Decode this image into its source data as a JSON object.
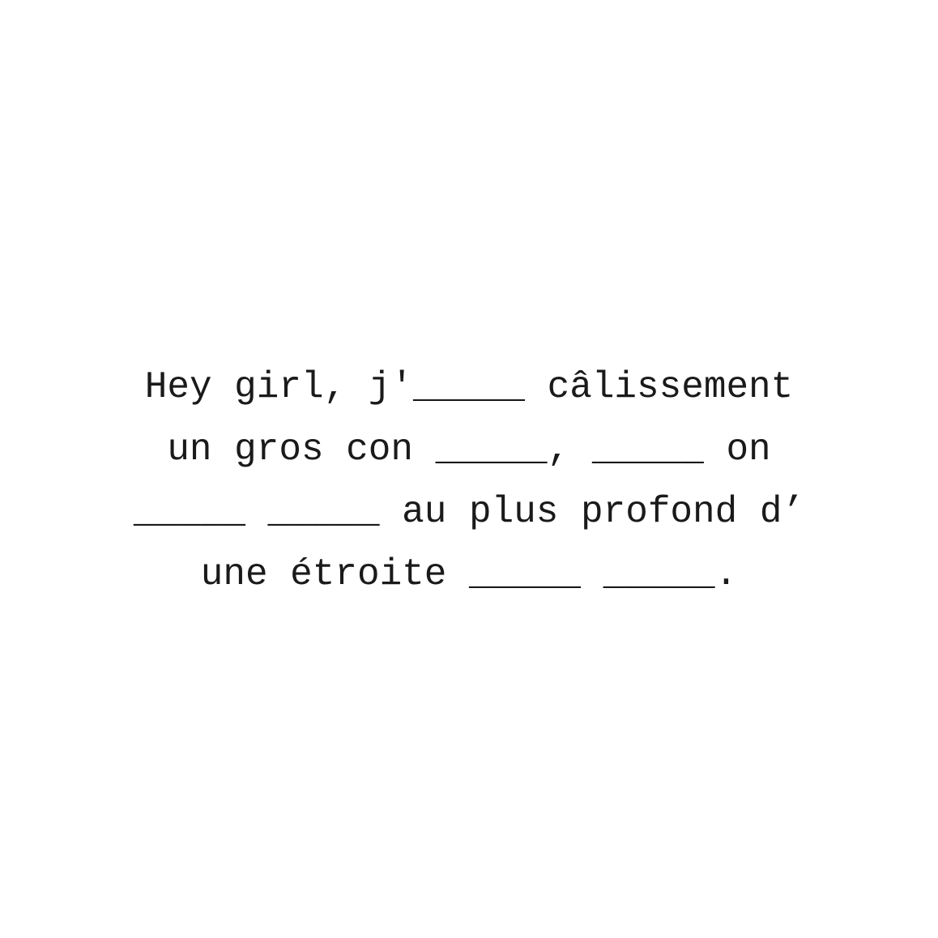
{
  "card": {
    "lines": [
      "Hey girl, j'_____ câlissement",
      "un gros con _____, _____ on",
      "_____ _____ au plus profond d’",
      "une étroite _____ _____."
    ]
  }
}
